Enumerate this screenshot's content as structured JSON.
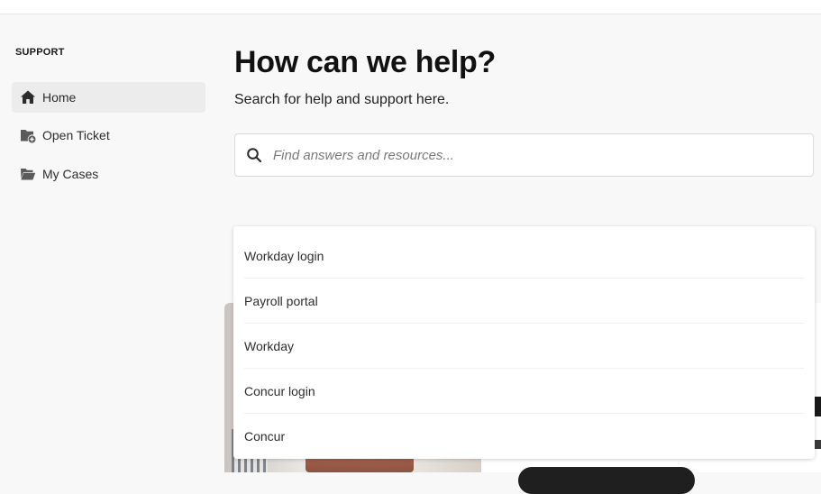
{
  "sidebar": {
    "heading": "SUPPORT",
    "items": [
      {
        "label": "Home",
        "icon": "home-icon",
        "active": true
      },
      {
        "label": "Open Ticket",
        "icon": "folder-add-icon",
        "active": false
      },
      {
        "label": "My Cases",
        "icon": "folder-open-icon",
        "active": false
      }
    ]
  },
  "main": {
    "title": "How can we help?",
    "subtitle": "Search for help and support here."
  },
  "search": {
    "placeholder": "Find answers and resources...",
    "value": "",
    "icon": "search-icon"
  },
  "suggestions": [
    "Workday login",
    "Payroll portal",
    "Workday",
    "Concur login",
    "Concur"
  ],
  "colors": {
    "page_bg": "#f8f8f8",
    "active_nav_bg": "#ececec",
    "text": "#1f1f1f"
  }
}
